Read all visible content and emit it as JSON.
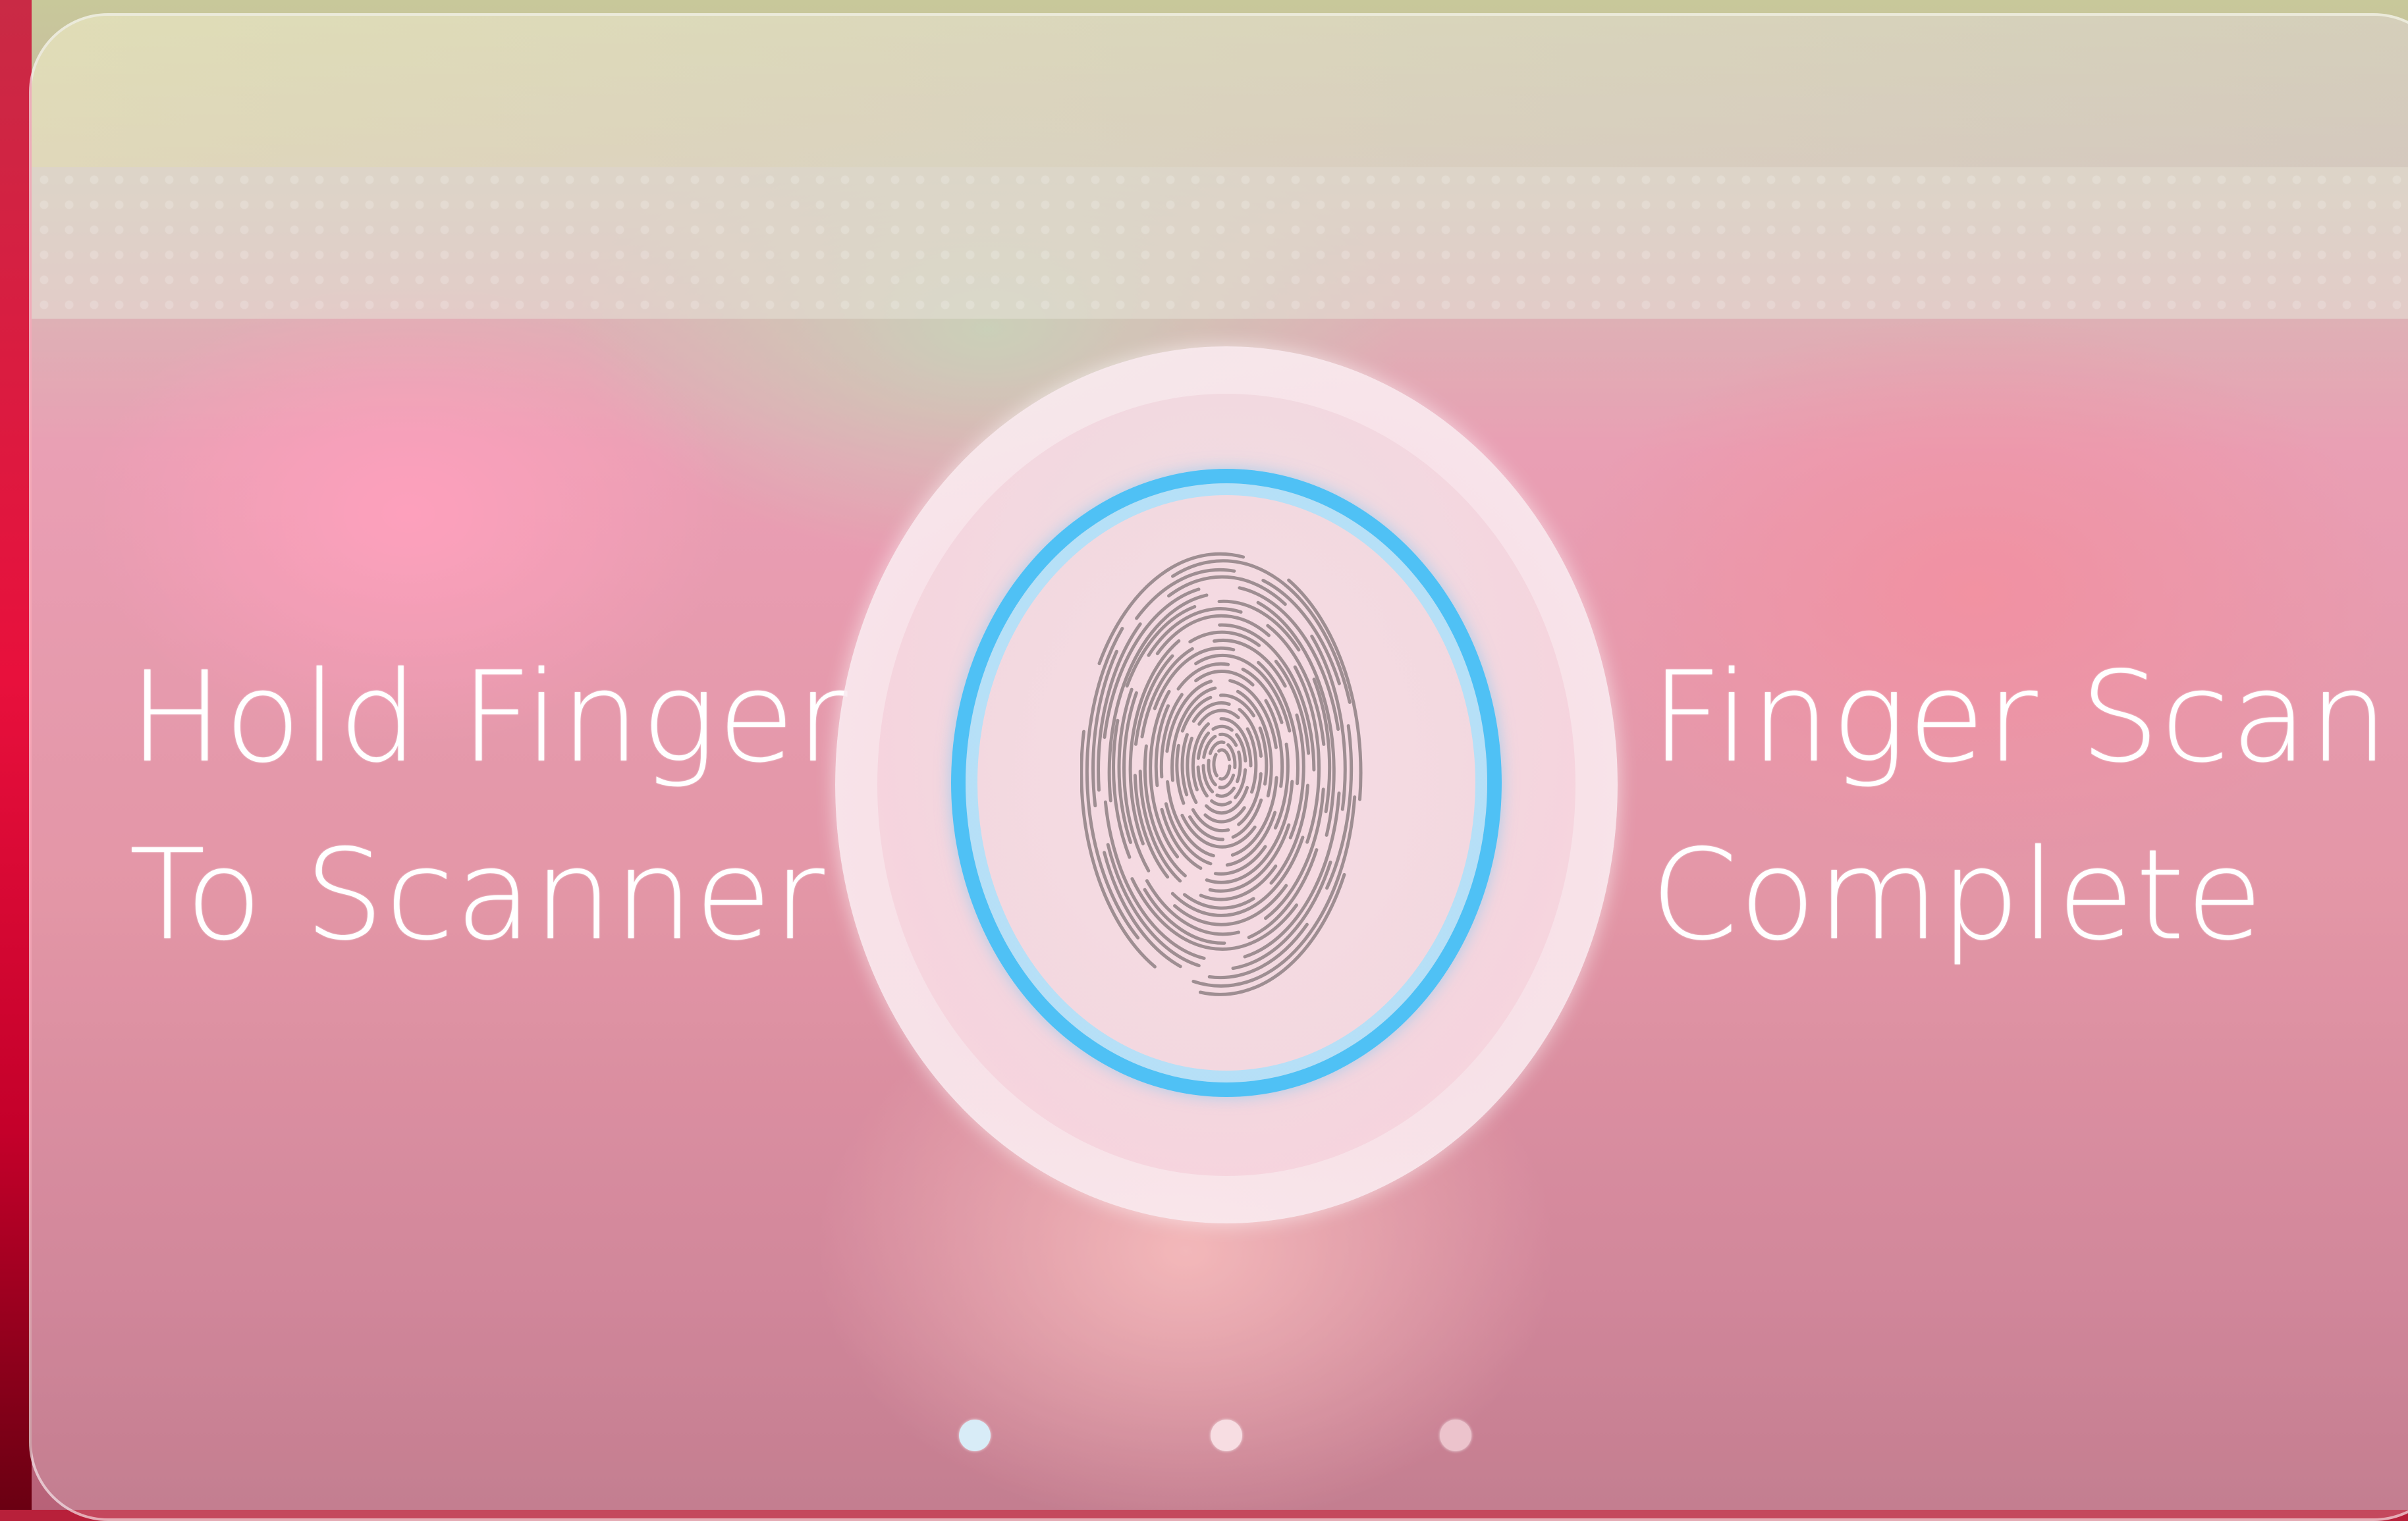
{
  "instructions": {
    "left_line1": "Hold Finger",
    "left_line2": "To Scanner"
  },
  "status": {
    "right_line1": "Finger Scan",
    "right_line2": "Complete"
  },
  "scanner": {
    "icon": "fingerprint-icon",
    "ring_color": "#4fc1f5"
  },
  "pagination": {
    "total": 3,
    "active_index": 0,
    "colors": [
      "#d8ecf7",
      "#f7dde2",
      "#ecc3cc"
    ]
  }
}
